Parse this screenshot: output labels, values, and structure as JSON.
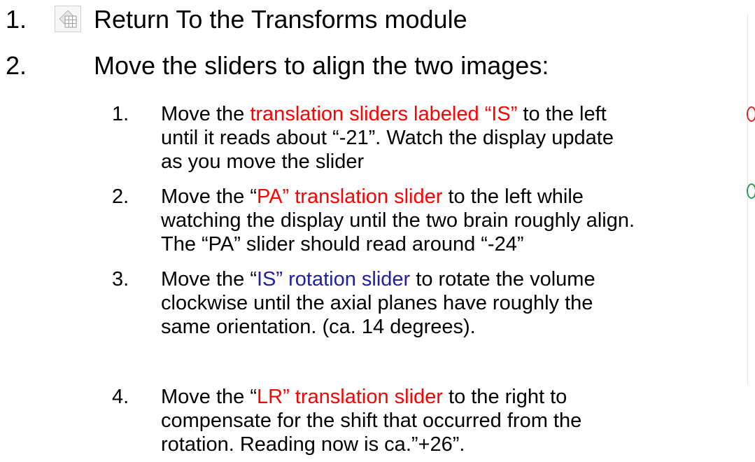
{
  "steps": [
    {
      "number": "1.",
      "text": "Return To the Transforms module",
      "icon": "transforms-module-icon"
    },
    {
      "number": "2.",
      "text": "Move the sliders to align the two images:"
    }
  ],
  "substeps": [
    {
      "number": "1.",
      "lines": [
        {
          "pre": "Move the ",
          "hl": "translation sliders labeled “IS”",
          "post": " to the left"
        },
        {
          "plain": "until it reads about “-21”. Watch the display update"
        },
        {
          "plain": "as you move the slider"
        }
      ]
    },
    {
      "number": "2.",
      "lines": [
        {
          "pre": "Move the “",
          "hl": "PA” translation slider",
          "post": " to the left while"
        },
        {
          "plain": "watching the display until the two brain roughly align."
        },
        {
          "plain": "The “PA” slider should read around “-24”"
        }
      ]
    },
    {
      "number": "3.",
      "lines": [
        {
          "pre": "Move the “",
          "hl": "IS” rotation slider",
          "post": " to rotate the volume"
        },
        {
          "plain": "clockwise until the axial planes have roughly the"
        },
        {
          "plain": "same orientation. (ca. 14 degrees)."
        }
      ]
    },
    {
      "number": "4.",
      "lines": [
        {
          "pre": "Move the “",
          "hl": "LR” translation slider",
          "post": " to the right to"
        },
        {
          "plain": "compensate for the shift that occurred from the"
        },
        {
          "plain": "rotation. Reading now is ca.”+26”."
        }
      ]
    }
  ],
  "colors": {
    "translation_highlight": "#ff0000",
    "rotation_highlight": "#2020a0",
    "marker_red": "#e02020",
    "marker_green": "#20a050"
  }
}
